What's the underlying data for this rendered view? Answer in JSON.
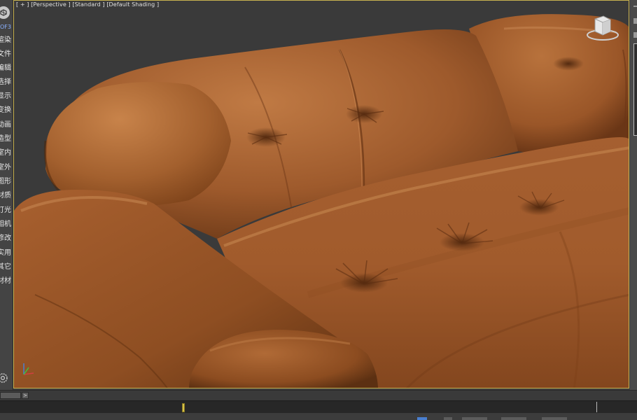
{
  "viewport": {
    "labels": [
      "[ + ]",
      "[Perspective ]",
      "[Standard ]",
      "[Default Shading ]"
    ]
  },
  "sidebar": {
    "top_label": "OF3",
    "items": [
      "渲染",
      "文件",
      "编辑",
      "选择",
      "显示",
      "变换",
      "动画",
      "造型",
      "室内",
      "室外",
      "图形",
      "材质",
      "灯光",
      "相机",
      "修改",
      "实用",
      "其它",
      "材材"
    ]
  },
  "timeline": {
    "next_label": ">"
  },
  "colors": {
    "viewport_border": "#c8b250",
    "leather": "#a55d2e",
    "background": "#3a3a3a",
    "accent_blue": "#4a7fd0"
  },
  "icons": {
    "logo": "max-logo-icon",
    "viewcube": "viewcube-icon",
    "axis": "axis-tripod-icon",
    "gear": "gear-icon"
  }
}
